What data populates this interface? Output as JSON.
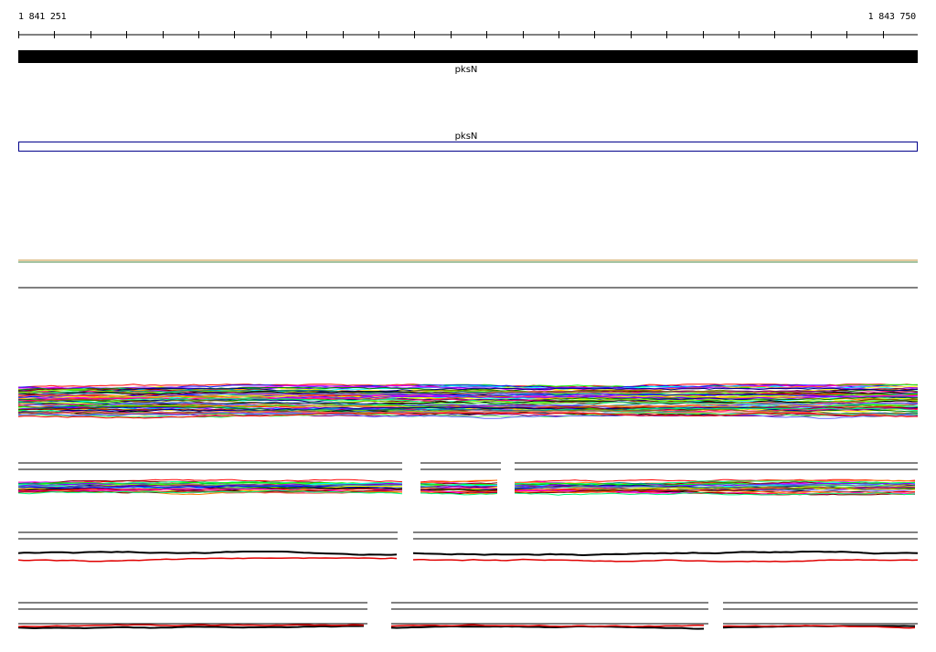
{
  "ruler": {
    "start_label": "1 841 251",
    "end_label": "1 843 750"
  },
  "tracks": {
    "gene_bar_label": "pksN",
    "gene_outline_label": "pksN",
    "gene_bar_color": "#000000",
    "gene_outline_color": "#00008b"
  },
  "chart_data": {
    "type": "line",
    "title": "",
    "x_range": [
      1841251,
      1843750
    ],
    "x_unit": "bp",
    "features": [
      {
        "name": "pksN",
        "style": "filled-bar"
      },
      {
        "name": "pksN",
        "style": "outline-box"
      }
    ],
    "profile_groups": [
      {
        "kind": "dense-multicolor",
        "lines": 70
      },
      {
        "kind": "multicolor-with-gaps",
        "segments": 3
      },
      {
        "kind": "black-red-with-gaps",
        "segments": 2
      },
      {
        "kind": "black-red-with-gaps",
        "segments": 3
      }
    ]
  }
}
